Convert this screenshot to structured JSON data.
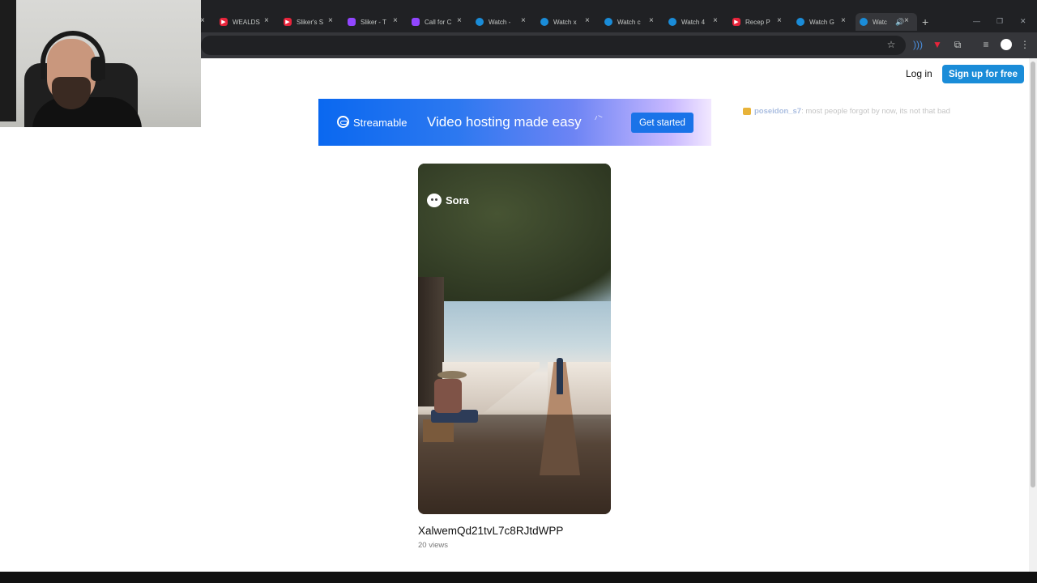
{
  "browser": {
    "tabs": [
      {
        "title": "WEALDS",
        "icon": "youtube-icon"
      },
      {
        "title": "Sliker's S",
        "icon": "youtube-icon"
      },
      {
        "title": "Sliker - T",
        "icon": "twitch-icon"
      },
      {
        "title": "Call for C",
        "icon": "twitch-icon"
      },
      {
        "title": "Watch -",
        "icon": "streamable-icon"
      },
      {
        "title": "Watch x",
        "icon": "streamable-icon"
      },
      {
        "title": "Watch c",
        "icon": "streamable-icon"
      },
      {
        "title": "Watch 4",
        "icon": "streamable-icon"
      },
      {
        "title": "Recep P",
        "icon": "youtube-icon"
      },
      {
        "title": "Watch G",
        "icon": "streamable-icon"
      },
      {
        "title": "Watc",
        "icon": "streamable-icon",
        "active": true
      }
    ],
    "close_glyph": "×",
    "new_tab_glyph": "+"
  },
  "header": {
    "login_label": "Log in",
    "signup_label": "Sign up for free"
  },
  "banner": {
    "brand": "Streamable",
    "tagline": "Video hosting made easy",
    "cta_label": "Get started",
    "gradient_start": "#0a68f0",
    "gradient_end": "#f2e8ff"
  },
  "chat": {
    "username": "poseidon_s7",
    "message": ": most people forgot by now, its not that bad"
  },
  "video": {
    "watermark": "Sora",
    "title": "XalwemQd21tvL7c8RJtdWPP",
    "views": "20 views"
  },
  "colors": {
    "accent": "#1a8cd8",
    "chrome_dark": "#202124"
  }
}
